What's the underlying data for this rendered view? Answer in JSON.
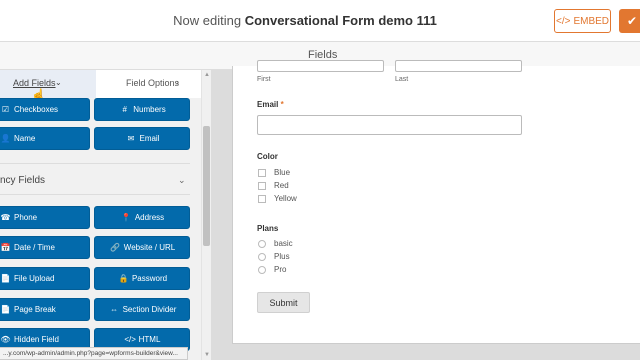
{
  "header": {
    "title_prefix": "Now editing",
    "title_form": "Conversational Form demo 111",
    "embed_label": "EMBED",
    "embed_icon": "</>",
    "save_icon": "✔"
  },
  "section": {
    "title": "Fields"
  },
  "panel": {
    "tab_add": "Add Fields",
    "tab_options": "Field Options"
  },
  "fields": {
    "row1": [
      {
        "icon": "☑",
        "label": "Checkboxes"
      },
      {
        "icon": "#",
        "label": "Numbers"
      }
    ],
    "row2": [
      {
        "icon": "👤",
        "label": "Name"
      },
      {
        "icon": "✉",
        "label": "Email"
      }
    ],
    "fancy_title": "ncy Fields",
    "fancy": [
      {
        "icon": "☎",
        "label": "Phone"
      },
      {
        "icon": "📍",
        "label": "Address"
      },
      {
        "icon": "📅",
        "label": "Date / Time"
      },
      {
        "icon": "🔗",
        "label": "Website / URL"
      },
      {
        "icon": "📄",
        "label": "File Upload"
      },
      {
        "icon": "🔒",
        "label": "Password"
      },
      {
        "icon": "📄",
        "label": "Page Break"
      },
      {
        "icon": "⇔",
        "label": "Section Divider"
      },
      {
        "icon": "👁",
        "label": "Hidden Field"
      },
      {
        "icon": "</>",
        "label": "HTML"
      }
    ]
  },
  "form": {
    "first_label": "First",
    "last_label": "Last",
    "email_label": "Email",
    "email_required": "*",
    "color_label": "Color",
    "color_options": [
      "Blue",
      "Red",
      "Yellow"
    ],
    "plans_label": "Plans",
    "plans_options": [
      "basic",
      "Plus",
      "Pro"
    ],
    "submit_label": "Submit"
  },
  "status_url": "...y.com/wp-admin/admin.php?page=wpforms-builder&view...",
  "colors": {
    "accent": "#e27730",
    "field_button": "#036aab"
  }
}
